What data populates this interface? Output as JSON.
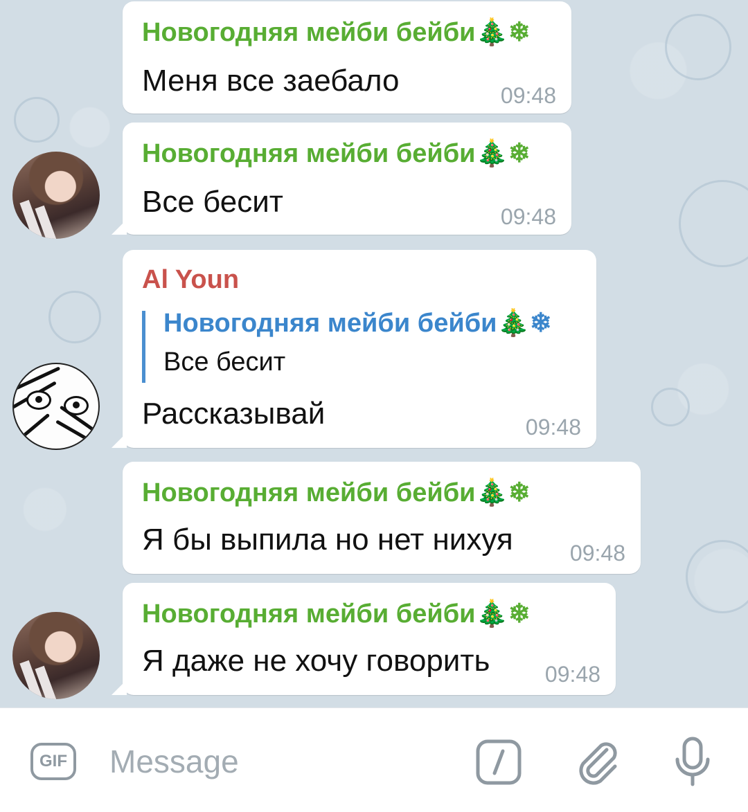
{
  "messages": [
    {
      "sender": "Новогодняя мейби бейби🎄❄",
      "text": "Меня все заебало",
      "time": "09:48"
    },
    {
      "sender": "Новогодняя мейби бейби🎄❄",
      "text": "Все бесит",
      "time": "09:48"
    },
    {
      "sender": "Al Youn",
      "reply_to_name": "Новогодняя мейби бейби🎄❄",
      "reply_to_text": "Все бесит",
      "text": "Рассказывай",
      "time": "09:48"
    },
    {
      "sender": "Новогодняя мейби бейби🎄❄",
      "text": "Я бы выпила но нет нихуя",
      "time": "09:48"
    },
    {
      "sender": "Новогодняя мейби бейби🎄❄",
      "text": "Я даже не хочу говорить",
      "time": "09:48"
    }
  ],
  "composer": {
    "gif_label": "GIF",
    "placeholder": "Message",
    "icons": [
      "gif-icon",
      "bot-command-icon",
      "paperclip-icon",
      "microphone-icon"
    ]
  },
  "colors": {
    "sender_green": "#58ad33",
    "sender_red": "#c9524c",
    "reply_blue": "#3b86cc",
    "time_gray": "#9aa5ad",
    "chat_background": "#d2dde5"
  }
}
